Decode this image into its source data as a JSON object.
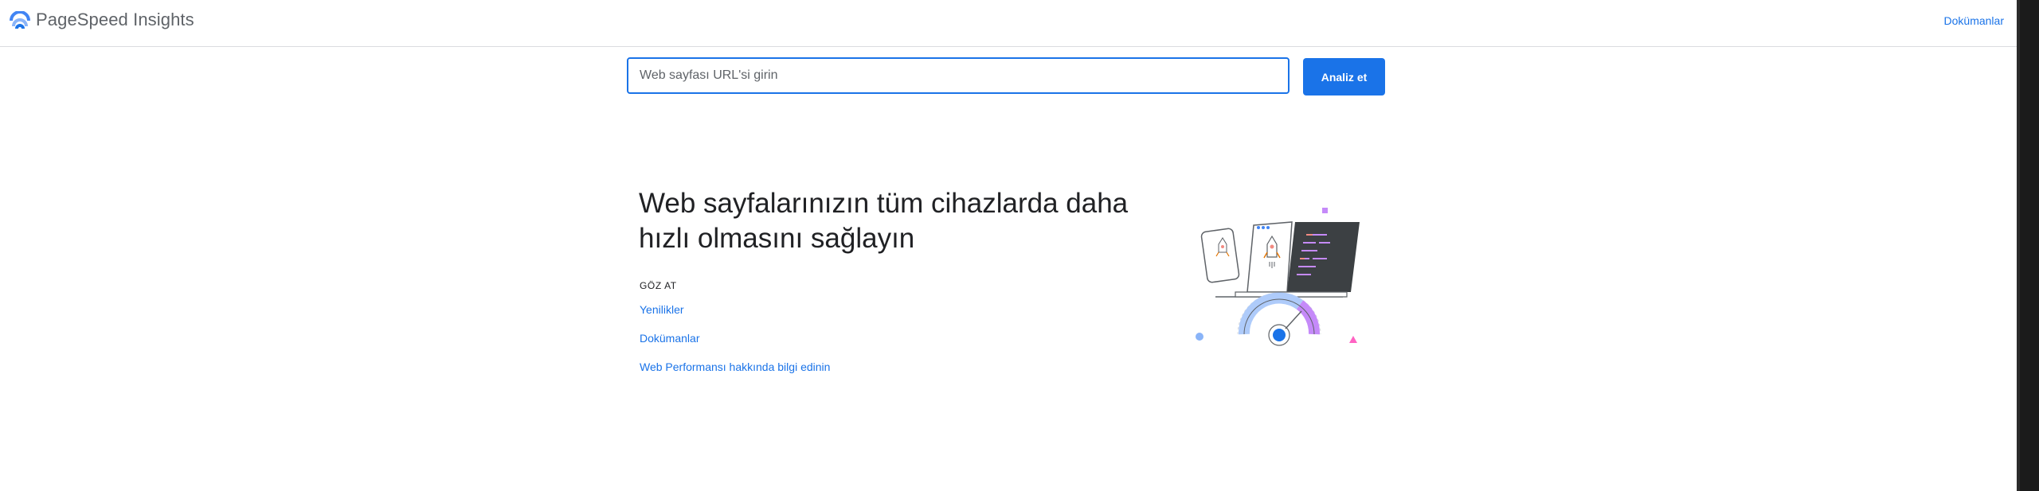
{
  "header": {
    "brand": "PageSpeed Insights",
    "docs_link": "Dokümanlar",
    "logo_icon": "pagespeed-gauge-icon"
  },
  "search": {
    "placeholder": "Web sayfası URL'si girin",
    "value": "",
    "button_label": "Analiz et"
  },
  "hero": {
    "title": "Web sayfalarınızın tüm cihazlarda daha hızlı olmasını sağlayın",
    "section_label": "GÖZ AT",
    "links": [
      "Yenilikler",
      "Dokümanlar",
      "Web Performansı hakkında bilgi edinin"
    ]
  },
  "colors": {
    "accent": "#1a73e8",
    "text": "#202124",
    "muted": "#5f6368"
  }
}
